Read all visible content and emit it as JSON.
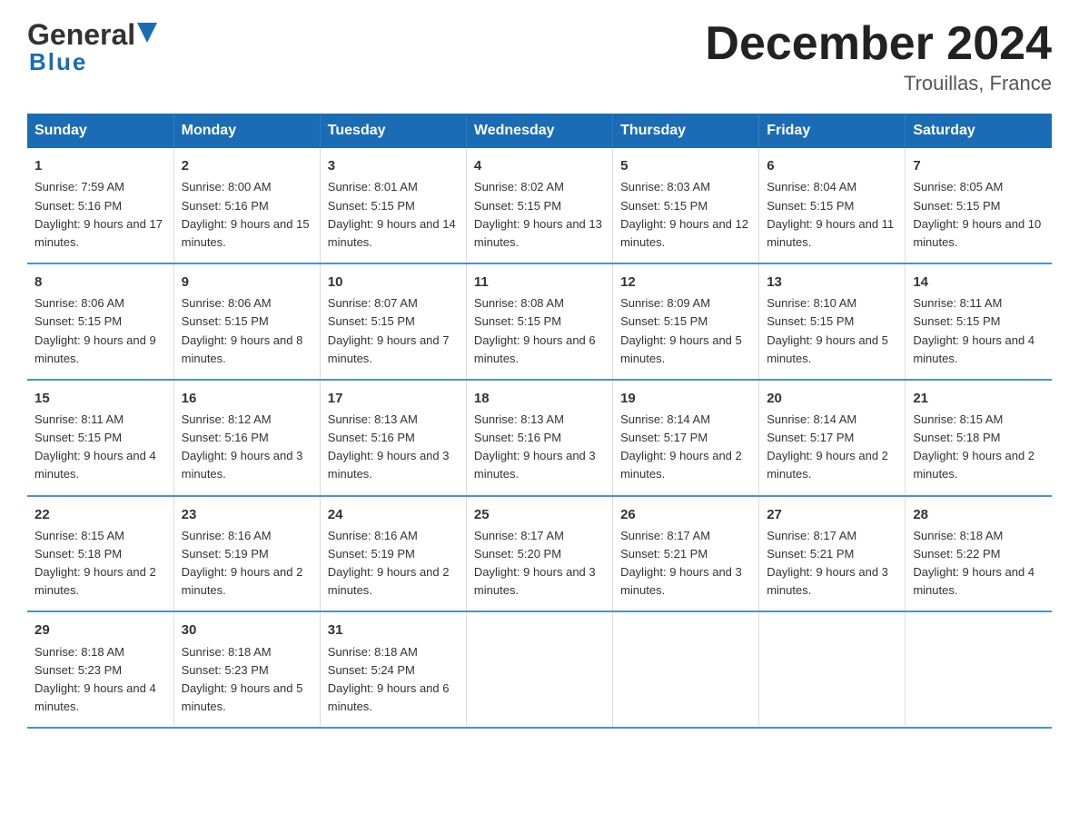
{
  "header": {
    "logo_text_general": "General",
    "logo_text_blue": "Blue",
    "month_title": "December 2024",
    "location": "Trouillas, France"
  },
  "days_of_week": [
    "Sunday",
    "Monday",
    "Tuesday",
    "Wednesday",
    "Thursday",
    "Friday",
    "Saturday"
  ],
  "weeks": [
    [
      {
        "day": "1",
        "sunrise": "Sunrise: 7:59 AM",
        "sunset": "Sunset: 5:16 PM",
        "daylight": "Daylight: 9 hours and 17 minutes."
      },
      {
        "day": "2",
        "sunrise": "Sunrise: 8:00 AM",
        "sunset": "Sunset: 5:16 PM",
        "daylight": "Daylight: 9 hours and 15 minutes."
      },
      {
        "day": "3",
        "sunrise": "Sunrise: 8:01 AM",
        "sunset": "Sunset: 5:15 PM",
        "daylight": "Daylight: 9 hours and 14 minutes."
      },
      {
        "day": "4",
        "sunrise": "Sunrise: 8:02 AM",
        "sunset": "Sunset: 5:15 PM",
        "daylight": "Daylight: 9 hours and 13 minutes."
      },
      {
        "day": "5",
        "sunrise": "Sunrise: 8:03 AM",
        "sunset": "Sunset: 5:15 PM",
        "daylight": "Daylight: 9 hours and 12 minutes."
      },
      {
        "day": "6",
        "sunrise": "Sunrise: 8:04 AM",
        "sunset": "Sunset: 5:15 PM",
        "daylight": "Daylight: 9 hours and 11 minutes."
      },
      {
        "day": "7",
        "sunrise": "Sunrise: 8:05 AM",
        "sunset": "Sunset: 5:15 PM",
        "daylight": "Daylight: 9 hours and 10 minutes."
      }
    ],
    [
      {
        "day": "8",
        "sunrise": "Sunrise: 8:06 AM",
        "sunset": "Sunset: 5:15 PM",
        "daylight": "Daylight: 9 hours and 9 minutes."
      },
      {
        "day": "9",
        "sunrise": "Sunrise: 8:06 AM",
        "sunset": "Sunset: 5:15 PM",
        "daylight": "Daylight: 9 hours and 8 minutes."
      },
      {
        "day": "10",
        "sunrise": "Sunrise: 8:07 AM",
        "sunset": "Sunset: 5:15 PM",
        "daylight": "Daylight: 9 hours and 7 minutes."
      },
      {
        "day": "11",
        "sunrise": "Sunrise: 8:08 AM",
        "sunset": "Sunset: 5:15 PM",
        "daylight": "Daylight: 9 hours and 6 minutes."
      },
      {
        "day": "12",
        "sunrise": "Sunrise: 8:09 AM",
        "sunset": "Sunset: 5:15 PM",
        "daylight": "Daylight: 9 hours and 5 minutes."
      },
      {
        "day": "13",
        "sunrise": "Sunrise: 8:10 AM",
        "sunset": "Sunset: 5:15 PM",
        "daylight": "Daylight: 9 hours and 5 minutes."
      },
      {
        "day": "14",
        "sunrise": "Sunrise: 8:11 AM",
        "sunset": "Sunset: 5:15 PM",
        "daylight": "Daylight: 9 hours and 4 minutes."
      }
    ],
    [
      {
        "day": "15",
        "sunrise": "Sunrise: 8:11 AM",
        "sunset": "Sunset: 5:15 PM",
        "daylight": "Daylight: 9 hours and 4 minutes."
      },
      {
        "day": "16",
        "sunrise": "Sunrise: 8:12 AM",
        "sunset": "Sunset: 5:16 PM",
        "daylight": "Daylight: 9 hours and 3 minutes."
      },
      {
        "day": "17",
        "sunrise": "Sunrise: 8:13 AM",
        "sunset": "Sunset: 5:16 PM",
        "daylight": "Daylight: 9 hours and 3 minutes."
      },
      {
        "day": "18",
        "sunrise": "Sunrise: 8:13 AM",
        "sunset": "Sunset: 5:16 PM",
        "daylight": "Daylight: 9 hours and 3 minutes."
      },
      {
        "day": "19",
        "sunrise": "Sunrise: 8:14 AM",
        "sunset": "Sunset: 5:17 PM",
        "daylight": "Daylight: 9 hours and 2 minutes."
      },
      {
        "day": "20",
        "sunrise": "Sunrise: 8:14 AM",
        "sunset": "Sunset: 5:17 PM",
        "daylight": "Daylight: 9 hours and 2 minutes."
      },
      {
        "day": "21",
        "sunrise": "Sunrise: 8:15 AM",
        "sunset": "Sunset: 5:18 PM",
        "daylight": "Daylight: 9 hours and 2 minutes."
      }
    ],
    [
      {
        "day": "22",
        "sunrise": "Sunrise: 8:15 AM",
        "sunset": "Sunset: 5:18 PM",
        "daylight": "Daylight: 9 hours and 2 minutes."
      },
      {
        "day": "23",
        "sunrise": "Sunrise: 8:16 AM",
        "sunset": "Sunset: 5:19 PM",
        "daylight": "Daylight: 9 hours and 2 minutes."
      },
      {
        "day": "24",
        "sunrise": "Sunrise: 8:16 AM",
        "sunset": "Sunset: 5:19 PM",
        "daylight": "Daylight: 9 hours and 2 minutes."
      },
      {
        "day": "25",
        "sunrise": "Sunrise: 8:17 AM",
        "sunset": "Sunset: 5:20 PM",
        "daylight": "Daylight: 9 hours and 3 minutes."
      },
      {
        "day": "26",
        "sunrise": "Sunrise: 8:17 AM",
        "sunset": "Sunset: 5:21 PM",
        "daylight": "Daylight: 9 hours and 3 minutes."
      },
      {
        "day": "27",
        "sunrise": "Sunrise: 8:17 AM",
        "sunset": "Sunset: 5:21 PM",
        "daylight": "Daylight: 9 hours and 3 minutes."
      },
      {
        "day": "28",
        "sunrise": "Sunrise: 8:18 AM",
        "sunset": "Sunset: 5:22 PM",
        "daylight": "Daylight: 9 hours and 4 minutes."
      }
    ],
    [
      {
        "day": "29",
        "sunrise": "Sunrise: 8:18 AM",
        "sunset": "Sunset: 5:23 PM",
        "daylight": "Daylight: 9 hours and 4 minutes."
      },
      {
        "day": "30",
        "sunrise": "Sunrise: 8:18 AM",
        "sunset": "Sunset: 5:23 PM",
        "daylight": "Daylight: 9 hours and 5 minutes."
      },
      {
        "day": "31",
        "sunrise": "Sunrise: 8:18 AM",
        "sunset": "Sunset: 5:24 PM",
        "daylight": "Daylight: 9 hours and 6 minutes."
      },
      null,
      null,
      null,
      null
    ]
  ]
}
